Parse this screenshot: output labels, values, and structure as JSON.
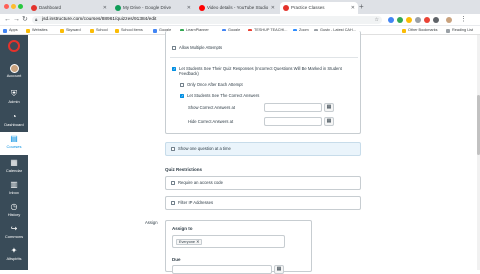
{
  "browser": {
    "tabs": [
      {
        "label": "Dashboard",
        "color": "#e4322b"
      },
      {
        "label": "My Drive - Google Drive",
        "color": "#0f9d58"
      },
      {
        "label": "Video details - YouTube Studio",
        "color": "#ff0000"
      },
      {
        "label": "Practice Classes",
        "color": "#e4322b"
      }
    ],
    "url": "jsd.instructure.com/courses/88961/quizzes/91384/edit",
    "bookmarks": [
      "Apps",
      "Websites",
      "Skyward",
      "School",
      "School items",
      "Google",
      "LearnPlanner",
      "Google",
      "TESHUP TEACHI...",
      "Zoom",
      "Gusty - Latest CAH...",
      "Other Bookmarks",
      "Reading List"
    ]
  },
  "sidebar": {
    "items": [
      {
        "label": "Account",
        "icon": "avatar"
      },
      {
        "label": "Admin",
        "icon": "shield-icon"
      },
      {
        "label": "Dashboard",
        "icon": "dashboard-icon"
      },
      {
        "label": "Courses",
        "icon": "book-icon"
      },
      {
        "label": "Calendar",
        "icon": "calendar-icon"
      },
      {
        "label": "Inbox",
        "icon": "inbox-icon"
      },
      {
        "label": "History",
        "icon": "clock-icon"
      },
      {
        "label": "Commons",
        "icon": "commons-icon"
      },
      {
        "label": "Altspirits",
        "icon": "altspirits-icon"
      }
    ]
  },
  "quiz": {
    "allow_multiple": "Allow Multiple Attempts",
    "see_responses": "Let Students See Their Quiz Responses (Incorrect Questions Will Be Marked in Student Feedback)",
    "only_once": "Only Once After Each Attempt",
    "see_correct": "Let Students See The Correct Answers",
    "show_correct_at": "Show Correct Answers at",
    "hide_correct_at": "Hide Correct Answers at",
    "one_question": "Show one question at a time",
    "restrictions_title": "Quiz Restrictions",
    "require_code": "Require an access code",
    "filter_ip": "Filter IP Addresses",
    "assign_label": "Assign",
    "assign_to": "Assign to",
    "assignee": "Everyone",
    "due": "Due"
  },
  "colors": {
    "accent": "#008ee2",
    "sidebar": "#394b58",
    "highlight": "#eaf4fb"
  }
}
